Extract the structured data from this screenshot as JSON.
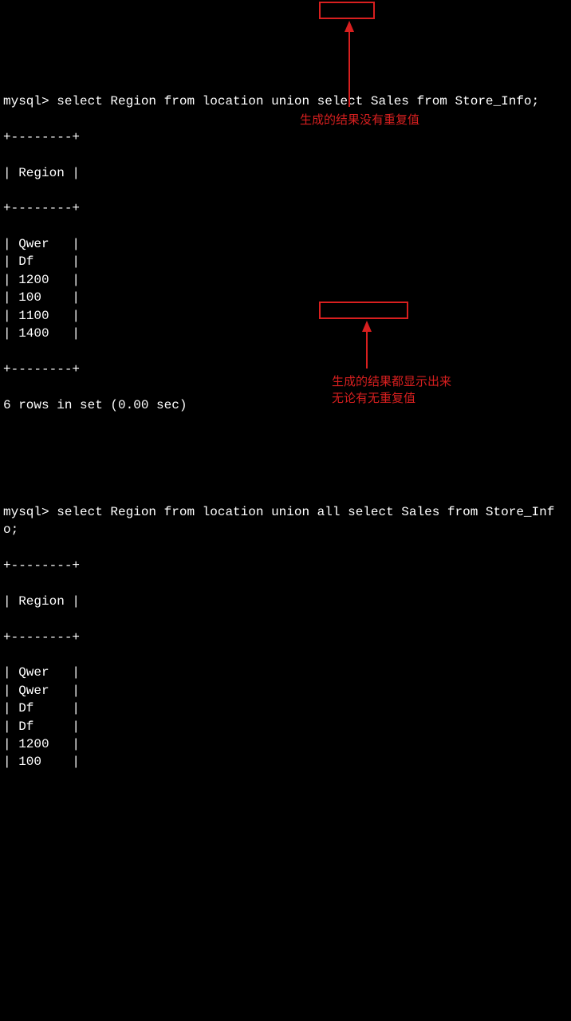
{
  "prompt": "mysql>",
  "query1": {
    "prefix": "mysql> select Region from location ",
    "keyword": "union",
    "suffix": " select Sales from Store_Info;",
    "header": "Region",
    "rows": [
      "Qwer",
      "Df",
      "1200",
      "100",
      "1100",
      "1400"
    ],
    "summary": "6 rows in set (0.00 sec)"
  },
  "annotation1": "生成的结果没有重复值",
  "query2": {
    "prefix": "mysql> select Region from location ",
    "keyword": "union all",
    "suffix": " select Sales from Store_Info;",
    "header": "Region",
    "rows": [
      "Qwer",
      "Qwer",
      "Df",
      "Df",
      "1200",
      "100"
    ]
  },
  "annotation2_line1": "生成的结果都显示出来",
  "annotation2_line2": "无论有无重复值",
  "table_border": "+--------+",
  "row_prefix": "| ",
  "row_pad_len": 7,
  "row_suffix": "|"
}
